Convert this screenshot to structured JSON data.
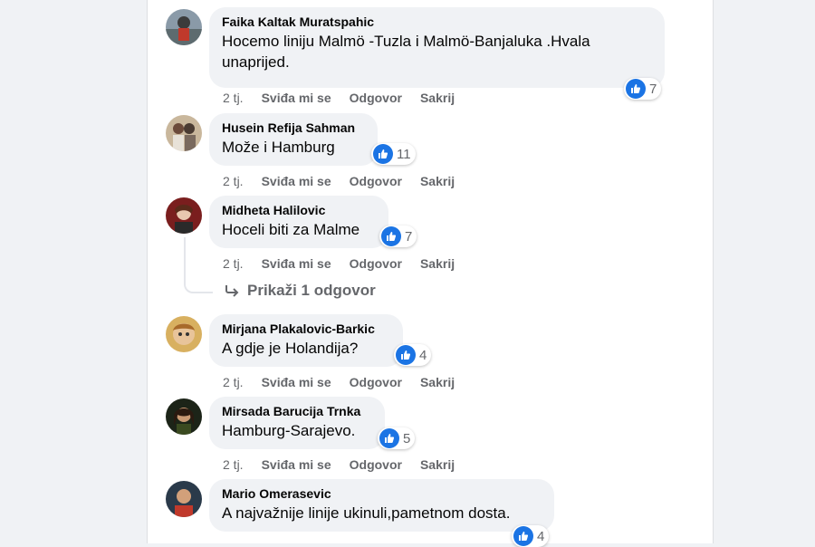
{
  "colors": {
    "like_blue": "#1b74e4",
    "bubble": "#f0f2f5",
    "meta_gray": "#65676b"
  },
  "comments": [
    {
      "author": "Faika Kaltak Muratspahic",
      "text_line1": "Hocemo liniju Malmö -Tuzla i Malmö-Banjaluka .Hvala",
      "text_line2": "unaprijed.",
      "likes": "7",
      "time": "2 tj.",
      "like_label": "Sviđa mi se",
      "reply_label": "Odgovor",
      "hide_label": "Sakrij"
    },
    {
      "author": "Husein Refija Sahman",
      "text": "Može i Hamburg",
      "likes": "11",
      "time": "2 tj.",
      "like_label": "Sviđa mi se",
      "reply_label": "Odgovor",
      "hide_label": "Sakrij"
    },
    {
      "author": "Midheta Halilovic",
      "text": "Hoceli biti za Malme",
      "likes": "7",
      "time": "2 tj.",
      "like_label": "Sviđa mi se",
      "reply_label": "Odgovor",
      "hide_label": "Sakrij"
    },
    {
      "author": "Mirjana Plakalovic-Barkic",
      "text": "A gdje je Holandija?",
      "likes": "4",
      "time": "2 tj.",
      "like_label": "Sviđa mi se",
      "reply_label": "Odgovor",
      "hide_label": "Sakrij"
    },
    {
      "author": "Mirsada Barucija Trnka",
      "text": "Hamburg-Sarajevo.",
      "likes": "5",
      "time": "2 tj.",
      "like_label": "Sviđa mi se",
      "reply_label": "Odgovor",
      "hide_label": "Sakrij"
    },
    {
      "author": "Mario Omerasevic",
      "text": "A najvažnije linije ukinuli,pametnom dosta.",
      "likes": "4"
    }
  ],
  "show_replies": "Prikaži 1 odgovor",
  "icons": {
    "like": "thumbs-up-icon",
    "reply_arrow": "reply-arrow-icon"
  }
}
